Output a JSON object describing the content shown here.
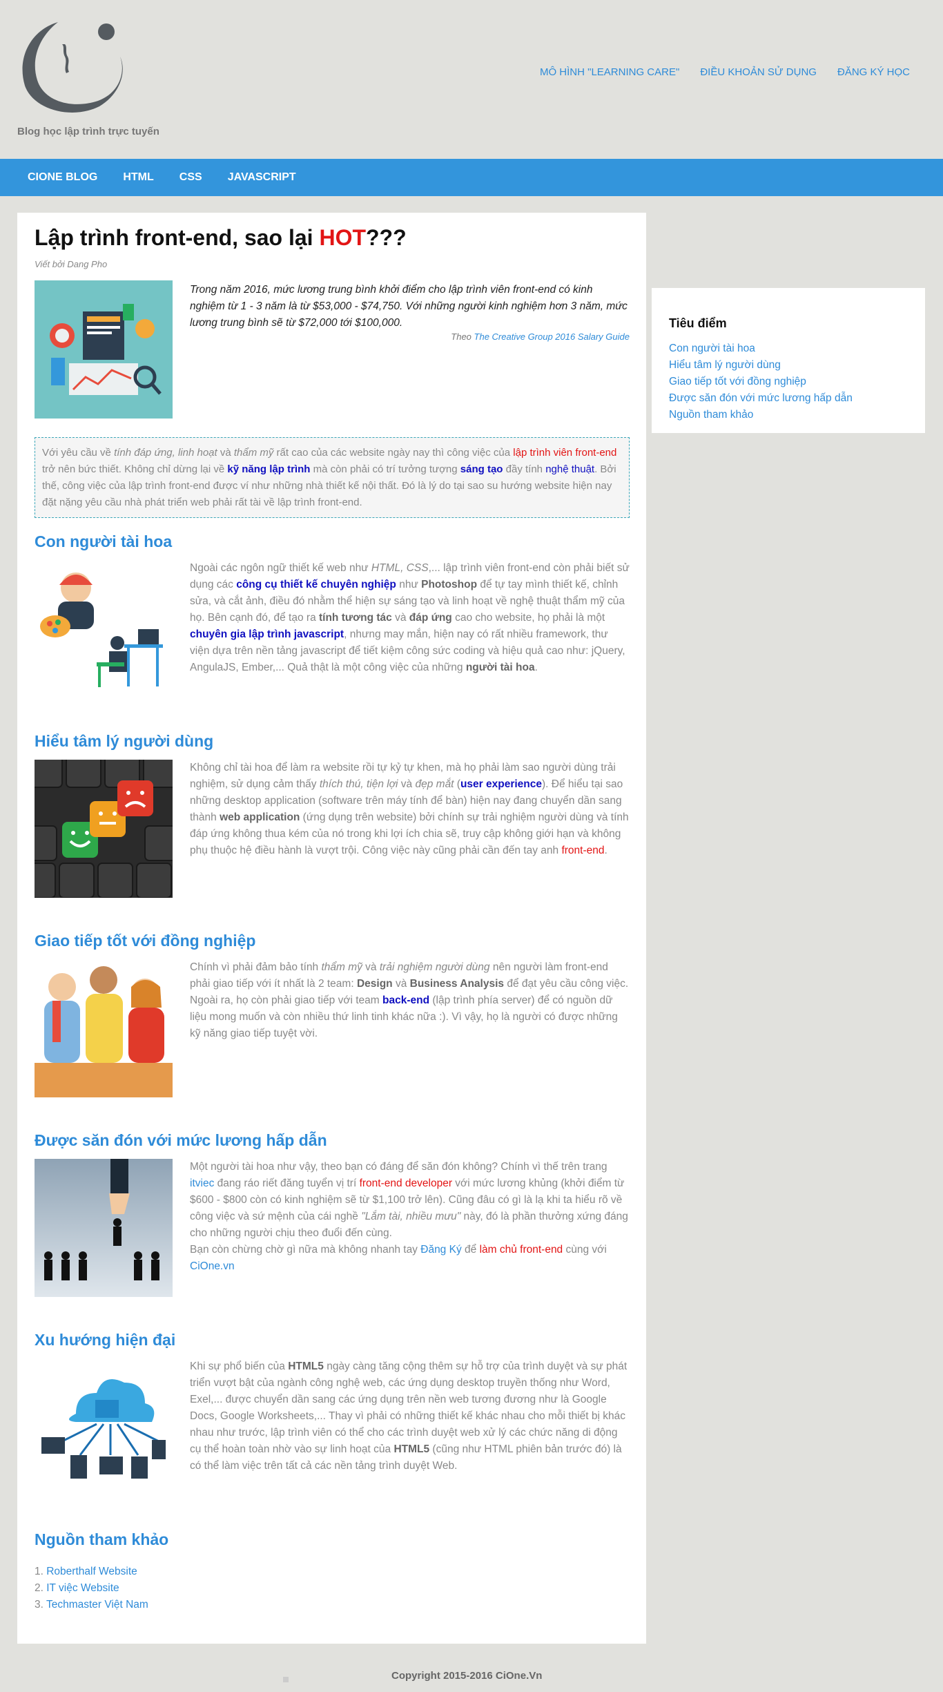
{
  "header": {
    "logo_caption": "Blog học lập trình trực tuyến",
    "top_links": [
      "MÔ HÌNH \"LEARNING CARE\"",
      "ĐIỀU KHOẢN SỬ DỤNG",
      "ĐĂNG KÝ HỌC"
    ]
  },
  "nav": [
    "CIONE BLOG",
    "HTML",
    "CSS",
    "JAVASCRIPT"
  ],
  "article": {
    "title_pre": "Lập trình front-end, sao lại ",
    "title_hot": "HOT",
    "title_post": "???",
    "byline": "Viết bởi Dang Pho",
    "quote": "Trong năm 2016, mức lương trung bình khởi điểm cho lập trình viên front-end có kinh nghiệm từ 1 - 3 năm là từ $53,000 - $74,750. Với những người kinh nghiệm hơn 3 năm, mức lương trung bình sẽ từ $72,000 tới $100,000.",
    "quote_src_pre": "Theo ",
    "quote_src_link": "The Creative Group 2016 Salary Guide"
  },
  "callout": {
    "p1": "Với yêu cầu về ",
    "p1i": "tính đáp ứng, linh hoạt",
    "p2": " và ",
    "p2i": "thẩm mỹ",
    "p3": " rất cao của các website ngày nay thì công việc của ",
    "link1": "lập trình viên front-end",
    "p4": " trở nên bức thiết. Không chỉ dừng lại về ",
    "link2": "kỹ năng lập trình",
    "p5": " mà còn phải có trí tưởng tượng ",
    "link3": "sáng tạo",
    "p6": " đầy tính ",
    "link4": "nghệ thuật",
    "p7": ". Bởi thế, công việc của lập trình front-end được ví như những nhà thiết kế nội thất. Đó là lý do tại sao su hướng website hiện nay đặt nặng yêu cầu nhà phát triển web phải rất tài về lập trình front-end."
  },
  "sections": {
    "s1": {
      "title": "Con người tài hoa",
      "a": "Ngoài các ngôn ngữ thiết kế web như ",
      "ai": "HTML, CSS",
      "b": ",... lập trình viên front-end còn phải biết sử dụng các ",
      "l1": "công cụ thiết kế chuyên nghiệp",
      "c": " như ",
      "b1": "Photoshop",
      "d": " để tự tay mình thiết kế, chỉnh sửa, và cắt ảnh, điều đó nhằm thể hiện sự sáng tạo và linh hoạt về nghệ thuật thẩm mỹ của họ. Bên cạnh đó, để tạo ra ",
      "b2": "tính tương tác",
      "e": " và ",
      "b3": "đáp ứng",
      "f": " cao cho website, họ phải là một ",
      "l2": "chuyên gia lập trình javascript",
      "g": ", nhưng may mắn, hiện nay có rất nhiều framework, thư viện dựa trên nền tảng javascript để tiết kiệm công sức coding và hiệu quả cao như: jQuery, AngulaJS, Ember,... Quả thật là một công việc của những ",
      "b4": "người tài hoa",
      "h": "."
    },
    "s2": {
      "title": "Hiểu tâm lý người dùng",
      "a": "Không chỉ tài hoa để làm ra website rồi tự kỷ tự khen, mà họ phải làm sao người dùng trải nghiệm, sử dụng cảm thấy ",
      "ai": "thích thú, tiện lợi",
      "b": " và ",
      "bi": "đẹp mắt",
      "c": " (",
      "l1": "user experience",
      "d": "). Để hiểu tại sao những desktop application (software trên máy tính để bàn) hiện nay đang chuyển dần sang thành ",
      "b1": "web application",
      "e": " (ứng dụng trên website) bởi chính sự trải nghiệm người dùng và tính đáp ứng không thua kém của nó trong khi lợi ích chia sẽ, truy cập không giới hạn và không phụ thuộc hệ điều hành là vượt trội. Công việc này cũng phải cần đến tay anh ",
      "r1": "front-end",
      "f": "."
    },
    "s3": {
      "title": "Giao tiếp tốt với đồng nghiệp",
      "a": "Chính vì phải đảm bảo tính ",
      "ai": "thẩm mỹ",
      "b": " và ",
      "bi": "trải nghiệm người dùng",
      "c": " nên người làm front-end phải giao tiếp với ít nhất là 2 team: ",
      "b1": "Design",
      "d": " và ",
      "b2": "Business Analysis",
      "e": " để đạt yêu cầu công việc. Ngoài ra, họ còn phải giao tiếp với team ",
      "l1": "back-end",
      "f": " (lập trình phía server) để có nguồn dữ liệu mong muốn và còn nhiều thứ linh tinh khác nữa :). Vì vậy, họ là người có được những kỹ năng giao tiếp tuyệt vời."
    },
    "s4": {
      "title": "Được săn đón với mức lương hấp dẫn",
      "a": "Một người tài hoa như vậy, theo bạn có đáng để săn đón không? Chính vì thế trên trang ",
      "l1": "itviec",
      "b": " đang ráo riết đăng tuyển vị trí ",
      "r1": "front-end developer",
      "c": " với mức lương khủng (khởi điểm từ $600 - $800 còn có kinh nghiệm sẽ từ $1,100 trở lên). Cũng đâu có gì là lạ khi ta hiểu rõ về công việc và sứ mệnh của cái nghề ",
      "ci": "\"Lắm tài, nhiều mưu\"",
      "d": " này, đó là phần thưởng xứng đáng cho những người chịu theo đuổi đến cùng.",
      "e": "Bạn còn chừng chờ gì nữa mà không nhanh tay ",
      "l2": "Đăng Ký",
      "f": " để ",
      "r2": "làm chủ front-end",
      "g": " cùng với ",
      "l3": "CiOne.vn"
    },
    "s5": {
      "title": "Xu hướng hiện đại",
      "a": "Khi sự phổ biến của ",
      "b1": "HTML5",
      "b": " ngày càng tăng cộng thêm sự hỗ trợ của trình duyệt và sự phát triển vượt bật của ngành công nghệ web, các ứng dụng desktop truyền thống như Word, Exel,... được chuyển dần sang các ứng dụng trên nền web tương đương như là Google Docs, Google Worksheets,... Thay vì phải có những thiết kế khác nhau cho mỗi thiết bị khác nhau như trước, lập trình viên có thể cho các trình duyệt web xử lý các chức năng di động cụ thể hoàn toàn nhờ vào sự linh hoạt của ",
      "b2": "HTML5",
      "c": " (cũng như HTML phiên bản trước đó) là có thể làm việc trên tất cả các nền tảng trình duyệt Web."
    }
  },
  "refs": {
    "title": "Nguồn tham khảo",
    "items": [
      {
        "num": "1. ",
        "label": "Roberthalf Website"
      },
      {
        "num": "2. ",
        "label": "IT việc Website"
      },
      {
        "num": "3. ",
        "label": "Techmaster Việt Nam"
      }
    ]
  },
  "sidebar": {
    "title": "Tiêu điểm",
    "links": [
      "Con người tài hoa",
      "Hiểu tâm lý người dùng",
      "Giao tiếp tốt với đồng nghiệp",
      "Được săn đón với mức lương hấp dẫn",
      "Nguồn tham khảo"
    ]
  },
  "footer": {
    "copyright": "Copyright 2015-2016 CiOne.Vn"
  },
  "colors": {
    "accent": "#2e8bd8",
    "nav_bg": "#3395dc",
    "hot": "#e21515",
    "page_bg": "#e1e1dd"
  }
}
